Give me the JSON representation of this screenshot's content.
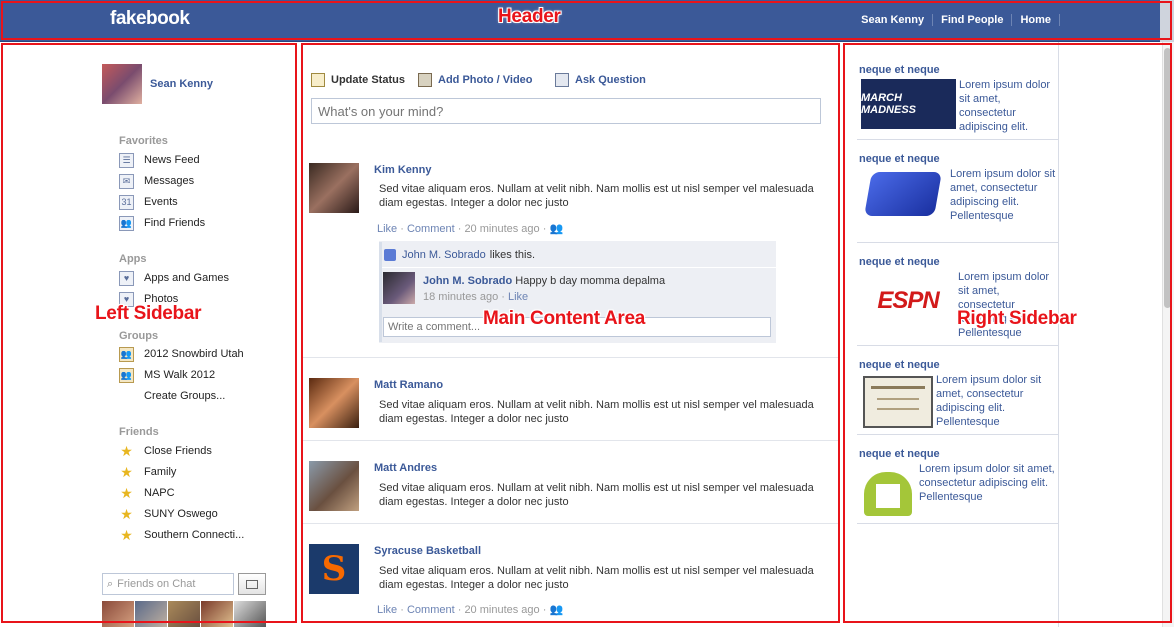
{
  "header": {
    "logo": "fakebook",
    "nav": [
      "Sean Kenny",
      "Find People",
      "Home"
    ]
  },
  "annotations": {
    "header": "Header",
    "left_sidebar": "Left Sidebar",
    "main": "Main Content Area",
    "right_sidebar": "Right Sidebar"
  },
  "left_sidebar": {
    "profile_name": "Sean Kenny",
    "favorites_head": "Favorites",
    "favorites": [
      "News Feed",
      "Messages",
      "Events",
      "Find Friends"
    ],
    "apps_head": "Apps",
    "apps": [
      "Apps and Games",
      "Photos"
    ],
    "groups_head": "Groups",
    "groups": [
      "2012 Snowbird Utah",
      "MS Walk 2012",
      "Create Groups..."
    ],
    "friends_head": "Friends",
    "friends": [
      "Close Friends",
      "Family",
      "NAPC",
      "SUNY Oswego",
      "Southern Connecti..."
    ],
    "chat_placeholder": "Friends on Chat"
  },
  "composer": {
    "tabs": [
      "Update Status",
      "Add Photo / Video",
      "Ask Question"
    ],
    "placeholder": "What's on your mind?"
  },
  "posts": [
    {
      "name": "Kim Kenny",
      "text": "Sed vitae aliquam eros. Nullam at velit nibh. Nam mollis est ut nisl semper vel malesuada diam egestas. Integer a dolor nec justo",
      "like": "Like",
      "comment": "Comment",
      "time": "20 minutes ago",
      "likes_name": "John M. Sobrado",
      "likes_suffix": "likes this.",
      "comment_author": "John M. Sobrado",
      "comment_text": "Happy b day momma depalma",
      "comment_time": "18 minutes ago",
      "comment_like": "Like",
      "write_comment": "Write a comment..."
    },
    {
      "name": "Matt Ramano",
      "text": "Sed vitae aliquam eros. Nullam at velit nibh. Nam mollis est ut nisl semper vel malesuada diam egestas. Integer a dolor nec justo"
    },
    {
      "name": "Matt Andres",
      "text": "Sed vitae aliquam eros. Nullam at velit nibh. Nam mollis est ut nisl semper vel malesuada diam egestas. Integer a dolor nec justo"
    },
    {
      "name": "Syracuse Basketball",
      "text": "Sed vitae aliquam eros. Nullam at velit nibh. Nam mollis est ut nisl semper vel malesuada diam egestas. Integer a dolor nec justo",
      "like": "Like",
      "comment": "Comment",
      "time": "20 minutes ago"
    }
  ],
  "ads": [
    {
      "title": "neque et neque",
      "text": "Lorem ipsum dolor sit amet, consectetur adipiscing elit.",
      "image_text": "MARCH MADNESS"
    },
    {
      "title": "neque et neque",
      "text": "Lorem ipsum dolor sit amet, consectetur adipiscing elit. Pellentesque"
    },
    {
      "title": "neque et neque",
      "text": "Lorem ipsum dolor sit amet, consectetur adipiscing elit. Pellentesque",
      "image_text": "ESPN"
    },
    {
      "title": "neque et neque",
      "text": "Lorem ipsum dolor sit amet, consectetur adipiscing elit. Pellentesque"
    },
    {
      "title": "neque et neque",
      "text": "Lorem ipsum dolor sit amet, consectetur adipiscing elit. Pellentesque"
    }
  ]
}
